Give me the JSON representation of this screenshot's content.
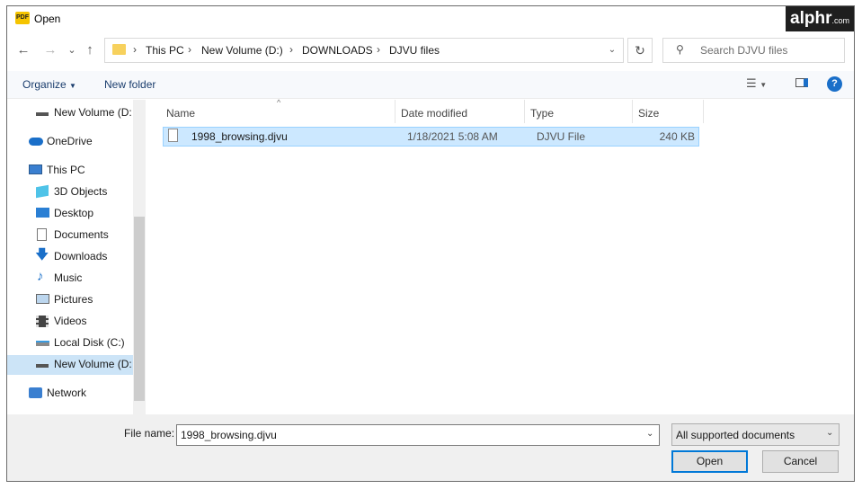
{
  "window": {
    "title": "Open",
    "app_icon_text": "PDF",
    "watermark": {
      "brand": "alphr",
      "suffix": ".com"
    }
  },
  "nav": {
    "back": "←",
    "forward": "→",
    "recent": "⌄",
    "up": "↑",
    "refresh": "↻"
  },
  "address": {
    "crumbs": [
      "This PC",
      "New Volume (D:)",
      "DOWNLOADS",
      "DJVU files"
    ],
    "separator": "›",
    "dropdown": "⌄"
  },
  "search": {
    "placeholder": "Search DJVU files",
    "icon": "search-icon"
  },
  "toolbar": {
    "organize": "Organize",
    "new_folder": "New folder",
    "help": "?"
  },
  "sidebar": {
    "items": [
      {
        "label": "New Volume (D:",
        "icon": "drive-icon"
      },
      {
        "label": "OneDrive",
        "icon": "cloud-icon"
      },
      {
        "label": "This PC",
        "icon": "computer-icon"
      },
      {
        "label": "3D Objects",
        "icon": "cube-icon"
      },
      {
        "label": "Desktop",
        "icon": "desktop-icon"
      },
      {
        "label": "Documents",
        "icon": "document-icon"
      },
      {
        "label": "Downloads",
        "icon": "download-icon"
      },
      {
        "label": "Music",
        "icon": "music-icon"
      },
      {
        "label": "Pictures",
        "icon": "picture-icon"
      },
      {
        "label": "Videos",
        "icon": "video-icon"
      },
      {
        "label": "Local Disk (C:)",
        "icon": "disk-icon"
      },
      {
        "label": "New Volume (D:",
        "icon": "drive-icon"
      },
      {
        "label": "Network",
        "icon": "network-icon"
      }
    ]
  },
  "file_list": {
    "columns": [
      "Name",
      "Date modified",
      "Type",
      "Size"
    ],
    "sort_indicator": "^",
    "rows": [
      {
        "name": "1998_browsing.djvu",
        "date": "1/18/2021 5:08 AM",
        "type": "DJVU File",
        "size": "240 KB"
      }
    ]
  },
  "footer": {
    "file_name_label": "File name:",
    "file_name_value": "1998_browsing.djvu",
    "file_type": "All supported documents",
    "open_label": "Open",
    "cancel_label": "Cancel"
  },
  "colors": {
    "selection": "#cce8ff",
    "nav_selected": "#cce4f7",
    "accent": "#0078d7",
    "toolbar_text": "#1a3d6d"
  }
}
